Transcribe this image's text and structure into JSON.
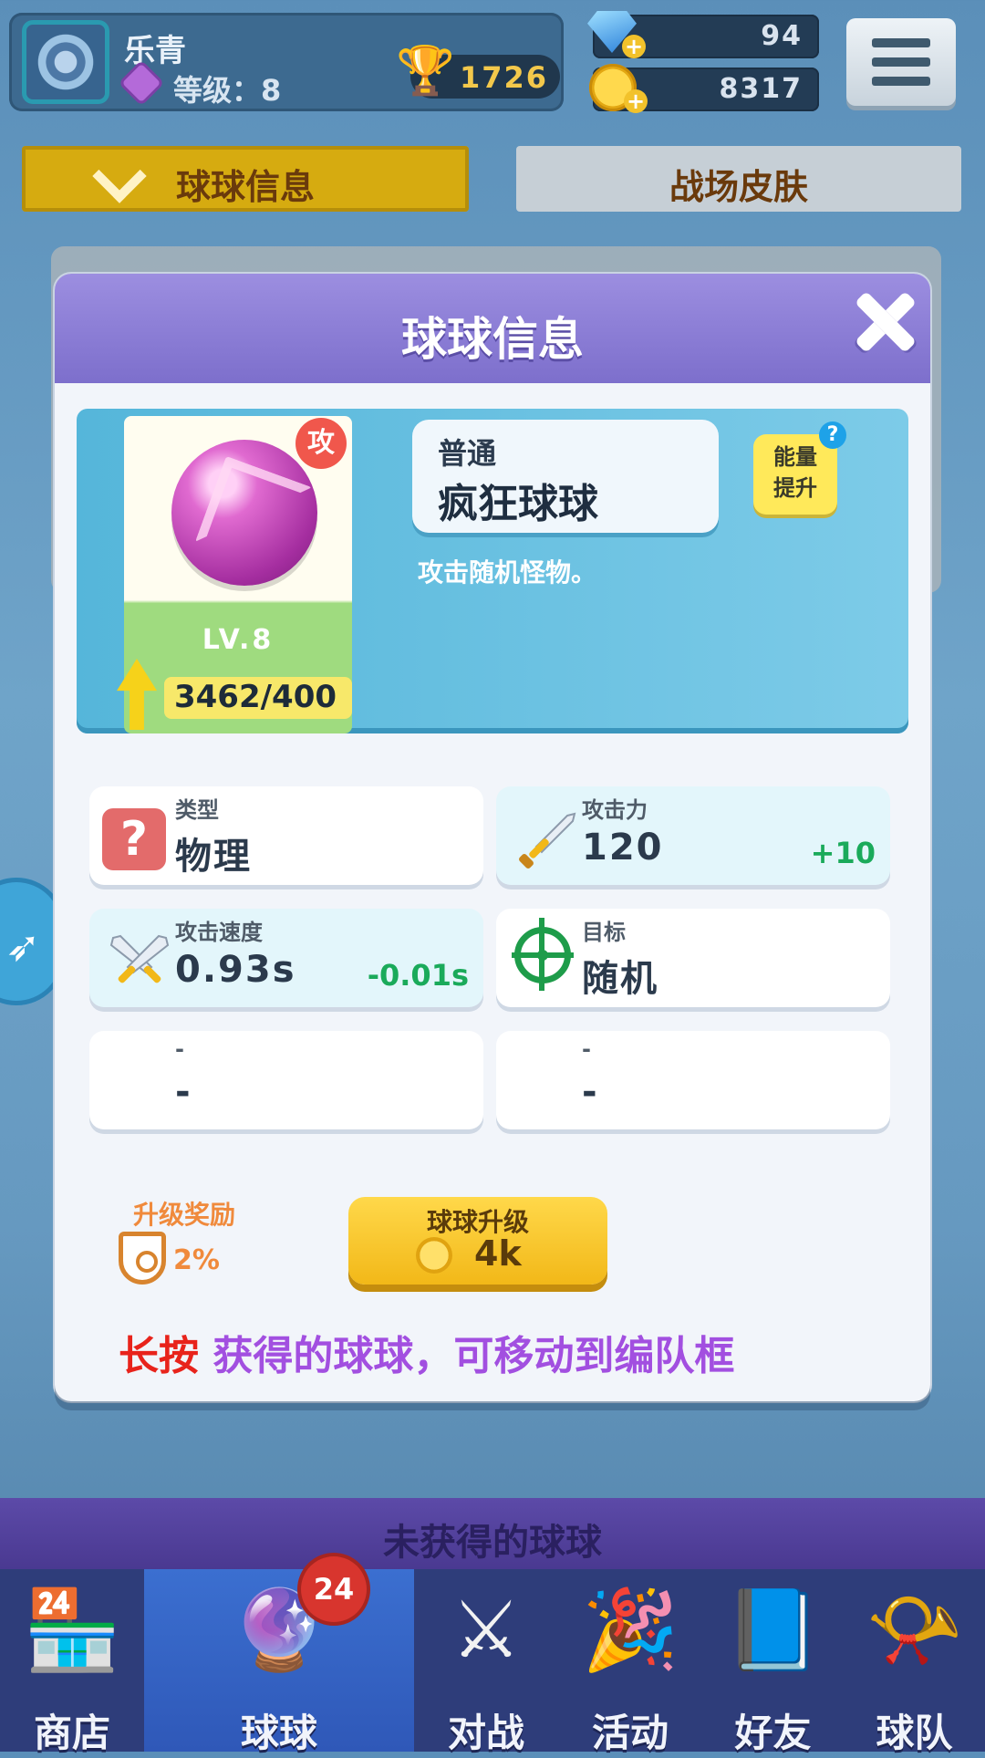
{
  "header": {
    "player_name": "乐青",
    "level_text": "等级：8",
    "trophies": "1726",
    "gems": "94",
    "coins": "8317"
  },
  "tabs": [
    {
      "label": "球球信息",
      "active": true
    },
    {
      "label": "战场皮肤",
      "active": false
    }
  ],
  "modal": {
    "title": "球球信息",
    "ball": {
      "attack_badge": "攻",
      "level": "LV.8",
      "progress": "3462/400",
      "rarity": "普通",
      "name": "疯狂球球",
      "description": "攻击随机怪物。"
    },
    "energy_button": "能量\n提升",
    "help": "?",
    "stats": [
      {
        "label": "类型",
        "value": "物理",
        "bonus": ""
      },
      {
        "label": "攻击力",
        "value": "120",
        "bonus": "+10"
      },
      {
        "label": "攻击速度",
        "value": "0.93s",
        "bonus": "-0.01s"
      },
      {
        "label": "目标",
        "value": "随机",
        "bonus": ""
      },
      {
        "label": "-",
        "value": "-",
        "bonus": ""
      },
      {
        "label": "-",
        "value": "-",
        "bonus": ""
      }
    ],
    "reward": {
      "title": "升级奖励",
      "value": "2%"
    },
    "upgrade": {
      "label": "球球升级",
      "cost": "4k"
    },
    "hint": {
      "strong": "长按",
      "rest": " 获得的球球，可移动到编队框"
    }
  },
  "unobtained_label": "未获得的球球",
  "nav": {
    "badge": "24",
    "items": [
      {
        "label": "商店",
        "icon": "shop-icon",
        "glyph": "🏪"
      },
      {
        "label": "球球",
        "icon": "ball-icon",
        "glyph": "🔮"
      },
      {
        "label": "对战",
        "icon": "crossed-swords-icon",
        "glyph": "⚔"
      },
      {
        "label": "活动",
        "icon": "party-popper-icon",
        "glyph": "🎉"
      },
      {
        "label": "好友",
        "icon": "friends-book-icon",
        "glyph": "📘"
      },
      {
        "label": "球队",
        "icon": "whistle-icon",
        "glyph": "📯"
      }
    ]
  },
  "colors": {
    "accent_purple": "#7d6fcc",
    "gold": "#f2b818",
    "bonus_green": "#1aaa5a",
    "hint_red": "#e8231b",
    "hint_purple": "#a24fe0"
  }
}
